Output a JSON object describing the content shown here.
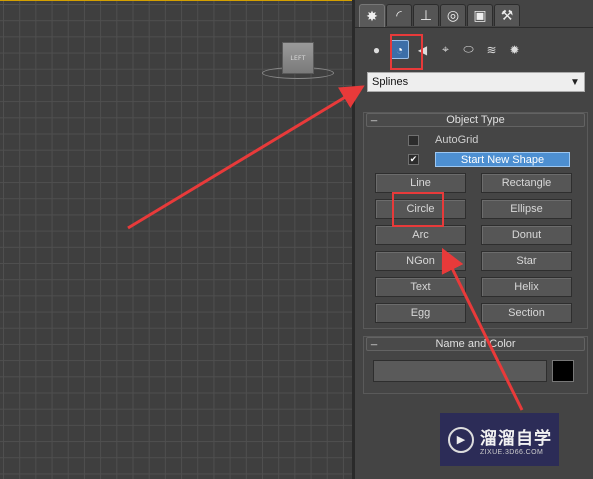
{
  "viewport": {
    "viewcube_label": "LEFT"
  },
  "command_panel": {
    "tabs": [
      {
        "icon": "create-icon",
        "glyph": "✸"
      },
      {
        "icon": "modify-icon",
        "glyph": "◜"
      },
      {
        "icon": "hierarchy-icon",
        "glyph": "⊥"
      },
      {
        "icon": "motion-icon",
        "glyph": "◎"
      },
      {
        "icon": "display-icon",
        "glyph": "▣"
      },
      {
        "icon": "utilities-icon",
        "glyph": "⚒"
      }
    ],
    "categories": [
      {
        "icon": "geometry-icon",
        "glyph": "●"
      },
      {
        "icon": "shapes-icon",
        "glyph": "◔"
      },
      {
        "icon": "lights-icon",
        "glyph": "◀"
      },
      {
        "icon": "cameras-icon",
        "glyph": "⌖"
      },
      {
        "icon": "helpers-icon",
        "glyph": "⬭"
      },
      {
        "icon": "space-warps-icon",
        "glyph": "≋"
      },
      {
        "icon": "systems-icon",
        "glyph": "✹"
      }
    ],
    "dropdown_value": "Splines"
  },
  "object_type": {
    "title": "Object Type",
    "collapse_glyph": "_",
    "autogrid_label": "AutoGrid",
    "autogrid_checked": false,
    "start_new_shape_checked": true,
    "start_new_shape_label": "Start New Shape",
    "buttons_left": [
      "Line",
      "Circle",
      "Arc",
      "NGon",
      "Text",
      "Egg"
    ],
    "buttons_right": [
      "Rectangle",
      "Ellipse",
      "Donut",
      "Star",
      "Helix",
      "Section"
    ]
  },
  "name_and_color": {
    "title": "Name and Color",
    "collapse_glyph": "_",
    "name_value": "",
    "color": "#000000"
  },
  "watermark": {
    "title": "溜溜自学",
    "url": "ZIXUE.3D66.COM"
  }
}
